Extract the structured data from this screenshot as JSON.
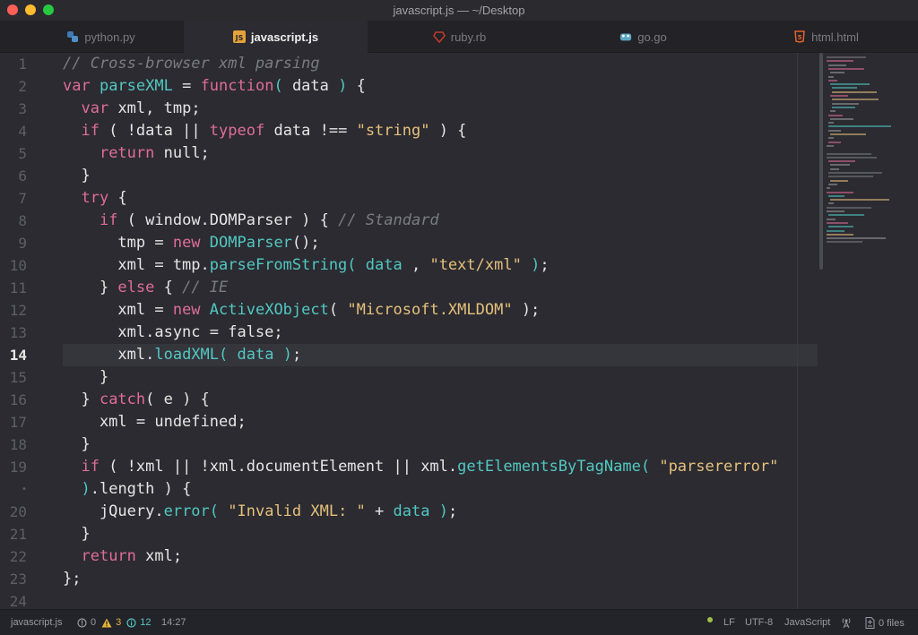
{
  "window": {
    "title": "javascript.js — ~/Desktop"
  },
  "tabs": [
    {
      "label": "python.py",
      "icon": "python-icon",
      "active": false
    },
    {
      "label": "javascript.js",
      "icon": "js-file-icon",
      "active": true
    },
    {
      "label": "ruby.rb",
      "icon": "ruby-icon",
      "active": false
    },
    {
      "label": "go.go",
      "icon": "go-gopher-icon",
      "active": false
    },
    {
      "label": "html.html",
      "icon": "html5-icon",
      "active": false
    }
  ],
  "editor": {
    "current_line": "14",
    "line_numbers": [
      "1",
      "2",
      "3",
      "4",
      "5",
      "6",
      "7",
      "8",
      "9",
      "10",
      "11",
      "12",
      "13",
      "14",
      "15",
      "16",
      "17",
      "18",
      "19",
      "•",
      "20",
      "21",
      "22",
      "23",
      "24"
    ],
    "lines": [
      [
        {
          "t": "// Cross-browser xml parsing",
          "c": "cmt"
        }
      ],
      [
        {
          "t": "var ",
          "c": "kw"
        },
        {
          "t": "parseXML",
          "c": "fn"
        },
        {
          "t": " = ",
          "c": "pl"
        },
        {
          "t": "function",
          "c": "kw"
        },
        {
          "t": "( ",
          "c": "fn"
        },
        {
          "t": "data",
          "c": "pl"
        },
        {
          "t": " ) ",
          "c": "fn"
        },
        {
          "t": "{",
          "c": "pl"
        }
      ],
      [
        {
          "t": "  ",
          "c": "pl"
        },
        {
          "t": "var ",
          "c": "kw"
        },
        {
          "t": "xml, tmp;",
          "c": "pl"
        }
      ],
      [
        {
          "t": "  ",
          "c": "pl"
        },
        {
          "t": "if",
          "c": "kw"
        },
        {
          "t": " ( !data || ",
          "c": "pl"
        },
        {
          "t": "typeof",
          "c": "kw"
        },
        {
          "t": " data !== ",
          "c": "pl"
        },
        {
          "t": "\"string\"",
          "c": "str"
        },
        {
          "t": " ) {",
          "c": "pl"
        }
      ],
      [
        {
          "t": "    ",
          "c": "pl"
        },
        {
          "t": "return",
          "c": "kw"
        },
        {
          "t": " null;",
          "c": "pl"
        }
      ],
      [
        {
          "t": "  }",
          "c": "pl"
        }
      ],
      [
        {
          "t": "  ",
          "c": "pl"
        },
        {
          "t": "try",
          "c": "kw"
        },
        {
          "t": " {",
          "c": "pl"
        }
      ],
      [
        {
          "t": "    ",
          "c": "pl"
        },
        {
          "t": "if",
          "c": "kw"
        },
        {
          "t": " ( window.DOMParser ) { ",
          "c": "pl"
        },
        {
          "t": "// Standard",
          "c": "cmt"
        }
      ],
      [
        {
          "t": "      tmp = ",
          "c": "pl"
        },
        {
          "t": "new",
          "c": "kw"
        },
        {
          "t": " ",
          "c": "pl"
        },
        {
          "t": "DOMParser",
          "c": "fn"
        },
        {
          "t": "();",
          "c": "pl"
        }
      ],
      [
        {
          "t": "      xml = tmp.",
          "c": "pl"
        },
        {
          "t": "parseFromString(",
          "c": "fn"
        },
        {
          "t": " ",
          "c": "pl"
        },
        {
          "t": "data",
          "c": "fn"
        },
        {
          "t": " , ",
          "c": "pl"
        },
        {
          "t": "\"text/xml\"",
          "c": "str"
        },
        {
          "t": " ",
          "c": "pl"
        },
        {
          "t": ")",
          "c": "fn"
        },
        {
          "t": ";",
          "c": "pl"
        }
      ],
      [
        {
          "t": "    } ",
          "c": "pl"
        },
        {
          "t": "else",
          "c": "kw"
        },
        {
          "t": " { ",
          "c": "pl"
        },
        {
          "t": "// IE",
          "c": "cmt"
        }
      ],
      [
        {
          "t": "      xml = ",
          "c": "pl"
        },
        {
          "t": "new",
          "c": "kw"
        },
        {
          "t": " ",
          "c": "pl"
        },
        {
          "t": "ActiveXObject",
          "c": "fn"
        },
        {
          "t": "( ",
          "c": "pl"
        },
        {
          "t": "\"Microsoft.XMLDOM\"",
          "c": "str"
        },
        {
          "t": " );",
          "c": "pl"
        }
      ],
      [
        {
          "t": "      xml.async = false;",
          "c": "pl"
        }
      ],
      [
        {
          "t": "      xml.",
          "c": "pl"
        },
        {
          "t": "loadXML(",
          "c": "fn"
        },
        {
          "t": " ",
          "c": "pl"
        },
        {
          "t": "data",
          "c": "fn"
        },
        {
          "t": " ",
          "c": "pl"
        },
        {
          "t": ")",
          "c": "fn"
        },
        {
          "t": ";",
          "c": "pl"
        }
      ],
      [
        {
          "t": "    }",
          "c": "pl"
        }
      ],
      [
        {
          "t": "  } ",
          "c": "pl"
        },
        {
          "t": "catch",
          "c": "kw"
        },
        {
          "t": "( e ) {",
          "c": "pl"
        }
      ],
      [
        {
          "t": "    xml = undefined;",
          "c": "pl"
        }
      ],
      [
        {
          "t": "  }",
          "c": "pl"
        }
      ],
      [
        {
          "t": "  ",
          "c": "pl"
        },
        {
          "t": "if",
          "c": "kw"
        },
        {
          "t": " ( !xml || !xml.documentElement || xml.",
          "c": "pl"
        },
        {
          "t": "getElementsByTagName(",
          "c": "fn"
        },
        {
          "t": " ",
          "c": "pl"
        },
        {
          "t": "\"parsererror\"",
          "c": "str"
        }
      ],
      [
        {
          "t": "  ",
          "c": "pl"
        },
        {
          "t": ")",
          "c": "fn"
        },
        {
          "t": ".length ) {",
          "c": "pl"
        }
      ],
      [
        {
          "t": "    jQuery.",
          "c": "pl"
        },
        {
          "t": "error(",
          "c": "fn"
        },
        {
          "t": " ",
          "c": "pl"
        },
        {
          "t": "\"Invalid XML: \"",
          "c": "str"
        },
        {
          "t": " + ",
          "c": "pl"
        },
        {
          "t": "data",
          "c": "fn"
        },
        {
          "t": " ",
          "c": "pl"
        },
        {
          "t": ")",
          "c": "fn"
        },
        {
          "t": ";",
          "c": "pl"
        }
      ],
      [
        {
          "t": "  }",
          "c": "pl"
        }
      ],
      [
        {
          "t": "  ",
          "c": "pl"
        },
        {
          "t": "return",
          "c": "kw"
        },
        {
          "t": " xml;",
          "c": "pl"
        }
      ],
      [
        {
          "t": "};",
          "c": "pl"
        }
      ],
      [
        {
          "t": "",
          "c": "pl"
        }
      ]
    ]
  },
  "status": {
    "file": "javascript.js",
    "errors": "0",
    "warnings": "3",
    "infos": "12",
    "cursor": "14:27",
    "line_ending": "LF",
    "encoding": "UTF-8",
    "grammar": "JavaScript",
    "files": "0 files"
  },
  "colors": {
    "keyword": "#e06c99",
    "function": "#52c8c2",
    "string": "#e6c07b",
    "comment": "#7b7b83",
    "background": "#2b2b31",
    "warning": "#e5b33a",
    "info": "#52c8c2"
  }
}
